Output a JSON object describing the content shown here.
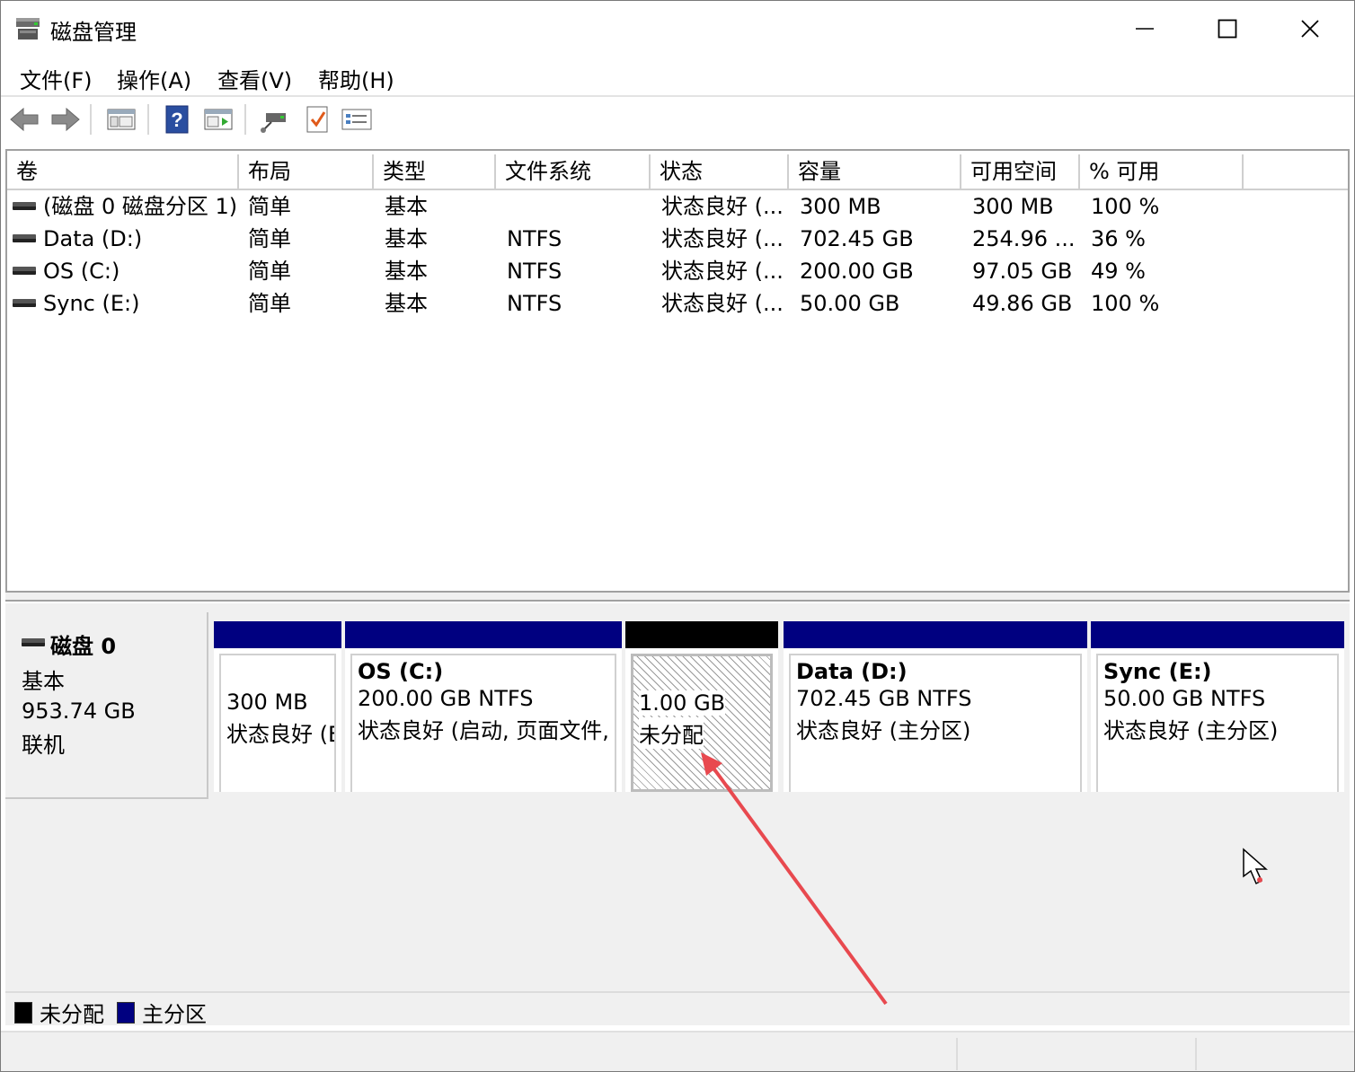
{
  "window": {
    "title": "磁盘管理",
    "controls": {
      "minimize": "minimize",
      "maximize": "maximize",
      "close": "close"
    }
  },
  "menu": [
    "文件(F)",
    "操作(A)",
    "查看(V)",
    "帮助(H)"
  ],
  "toolbar": {
    "icons": [
      "back-icon",
      "forward-icon",
      "show-hide-console-tree-icon",
      "help-icon",
      "show-hide-action-pane-icon",
      "connect-disk-icon",
      "check-icon",
      "properties-list-icon"
    ]
  },
  "volume_table": {
    "columns": [
      "卷",
      "布局",
      "类型",
      "文件系统",
      "状态",
      "容量",
      "可用空间",
      "% 可用"
    ],
    "rows": [
      {
        "volume": "(磁盘 0 磁盘分区 1)",
        "layout": "简单",
        "type": "基本",
        "fs": "",
        "status": "状态良好 (...",
        "capacity": "300 MB",
        "free": "300 MB",
        "pct": "100 %"
      },
      {
        "volume": "Data (D:)",
        "layout": "简单",
        "type": "基本",
        "fs": "NTFS",
        "status": "状态良好 (...",
        "capacity": "702.45 GB",
        "free": "254.96 ...",
        "pct": "36 %"
      },
      {
        "volume": "OS (C:)",
        "layout": "简单",
        "type": "基本",
        "fs": "NTFS",
        "status": "状态良好 (...",
        "capacity": "200.00 GB",
        "free": "97.05 GB",
        "pct": "49 %"
      },
      {
        "volume": "Sync (E:)",
        "layout": "简单",
        "type": "基本",
        "fs": "NTFS",
        "status": "状态良好 (...",
        "capacity": "50.00 GB",
        "free": "49.86 GB",
        "pct": "100 %"
      }
    ]
  },
  "disk": {
    "name": "磁盘 0",
    "type": "基本",
    "size": "953.74 GB",
    "state": "联机"
  },
  "partitions": [
    {
      "title": "",
      "line1": "300 MB",
      "line2": "状态良好 (E",
      "kind": "primary"
    },
    {
      "title": "OS  (C:)",
      "line1": "200.00 GB NTFS",
      "line2": "状态良好 (启动, 页面文件, 故",
      "kind": "primary"
    },
    {
      "title": "",
      "line1": "1.00 GB",
      "line2": "未分配",
      "kind": "unallocated"
    },
    {
      "title": "Data  (D:)",
      "line1": "702.45 GB NTFS",
      "line2": "状态良好 (主分区)",
      "kind": "primary"
    },
    {
      "title": "Sync  (E:)",
      "line1": "50.00 GB NTFS",
      "line2": "状态良好 (主分区)",
      "kind": "primary"
    }
  ],
  "legend": [
    {
      "label": "未分配",
      "color": "#000000"
    },
    {
      "label": "主分区",
      "color": "#000080"
    }
  ],
  "colors": {
    "primary_band": "#000080",
    "unallocated_band": "#000000",
    "annotation_arrow": "#e8494f"
  }
}
